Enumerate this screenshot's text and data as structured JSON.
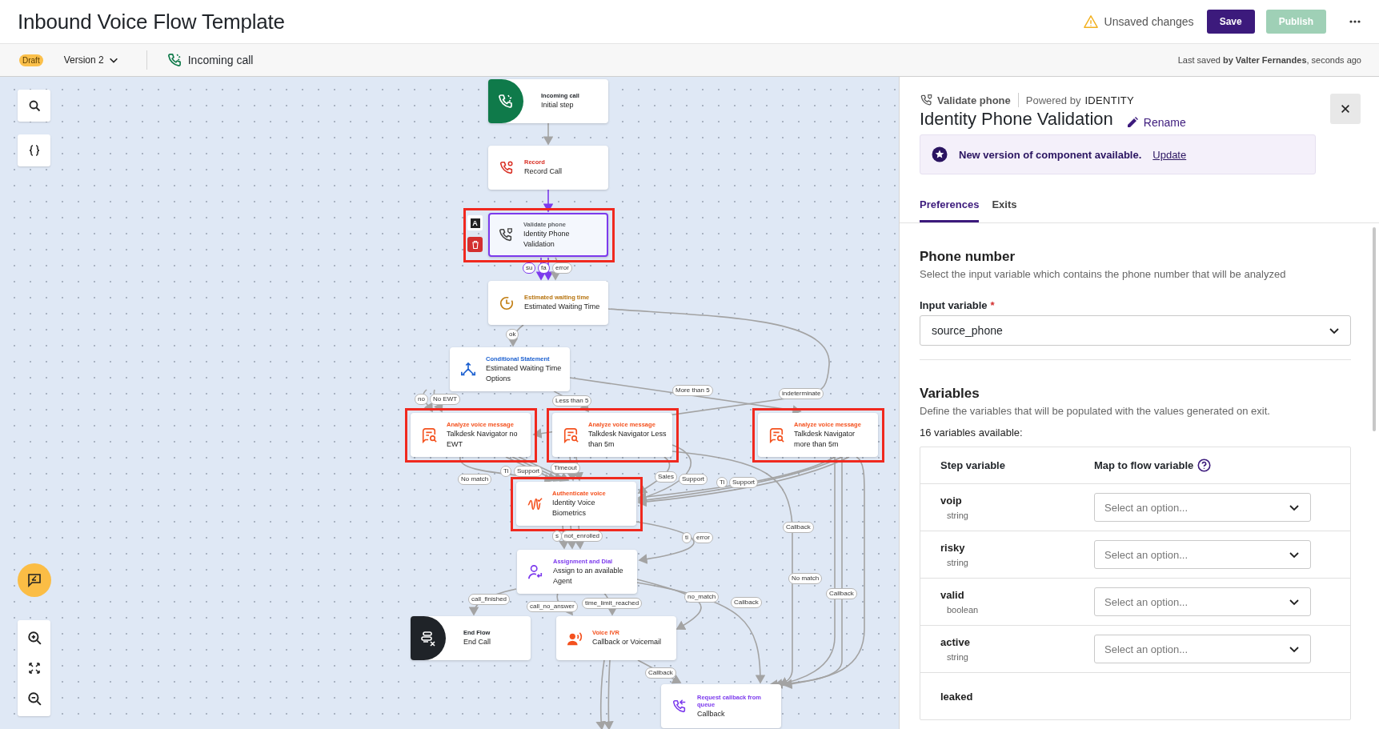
{
  "header": {
    "title": "Inbound Voice Flow Template",
    "status": "Unsaved changes",
    "buttons": [
      {
        "kind": "save",
        "label": "Save",
        "disabled": false
      },
      {
        "kind": "publish",
        "label": "Publish",
        "disabled": true
      }
    ]
  },
  "subbar": {
    "badge": "Draft",
    "version": "Version 2",
    "trigger": "Incoming call",
    "last_saved": "Last saved **by Valter Fernandes**, seconds ago"
  },
  "canvas": {
    "selected_tools": {
      "badge": "A"
    },
    "nodes": [
      {
        "kind": "start",
        "category": "Incoming call",
        "title": "Initial step",
        "color": "#1f2328",
        "selected": false,
        "highlighted": false
      },
      {
        "kind": "record",
        "category": "Record",
        "title": "Record Call",
        "color": "#d93025",
        "selected": false,
        "highlighted": false
      },
      {
        "kind": "validate",
        "category": "Validate phone",
        "title": "Identity Phone Validation",
        "color": "#5f6368",
        "selected": true,
        "highlighted": true
      },
      {
        "kind": "clock",
        "category": "Estimated waiting time",
        "title": "Estimated Waiting Time",
        "color": "#b7740f",
        "selected": false,
        "highlighted": false
      },
      {
        "kind": "branch",
        "category": "Conditional Statement",
        "title": "Estimated Waiting Time Options",
        "color": "#1a5fd0",
        "selected": false,
        "highlighted": false
      },
      {
        "kind": "analyze",
        "category": "Analyze voice message",
        "title": "Talkdesk Navigator no EWT",
        "color": "#f4511e",
        "selected": false,
        "highlighted": true
      },
      {
        "kind": "analyze",
        "category": "Analyze voice message",
        "title": "Talkdesk Navigator Less than 5m",
        "color": "#f4511e",
        "selected": false,
        "highlighted": true
      },
      {
        "kind": "analyze",
        "category": "Analyze voice message",
        "title": "Talkdesk Navigator more than 5m",
        "color": "#f4511e",
        "selected": false,
        "highlighted": true
      },
      {
        "kind": "biometrics",
        "category": "Authenticate voice",
        "title": "Identity Voice Biometrics",
        "color": "#f4511e",
        "selected": false,
        "highlighted": true
      },
      {
        "kind": "agent",
        "category": "Assignment and Dial",
        "title": "Assign to an available Agent",
        "color": "#7c3aed",
        "selected": false,
        "highlighted": false
      },
      {
        "kind": "end",
        "category": "End Flow",
        "title": "End Call",
        "color": "#1f2328",
        "selected": false,
        "highlighted": false
      },
      {
        "kind": "ivr",
        "category": "Voice IVR",
        "title": "Callback or Voicemail",
        "color": "#f4511e",
        "selected": false,
        "highlighted": false
      },
      {
        "kind": "callback",
        "category": "Request callback from queue",
        "title": "Callback",
        "color": "#7c3aed",
        "selected": false,
        "highlighted": false
      }
    ],
    "edge_labels": [
      {
        "text": "ok",
        "active": false
      },
      {
        "text": "su",
        "active": true
      },
      {
        "text": "fa",
        "active": true
      },
      {
        "text": "error",
        "active": false
      },
      {
        "text": "no",
        "active": false
      },
      {
        "text": "No EWT",
        "active": false
      },
      {
        "text": "Less than 5",
        "active": false
      },
      {
        "text": "More than 5",
        "active": false
      },
      {
        "text": "indeterminate",
        "active": false
      },
      {
        "text": "Ti",
        "active": false
      },
      {
        "text": "Support",
        "active": false
      },
      {
        "text": "Timeout",
        "active": false
      },
      {
        "text": "No match",
        "active": false
      },
      {
        "text": "Sales",
        "active": false
      },
      {
        "text": "Support",
        "active": false
      },
      {
        "text": "Ti",
        "active": false
      },
      {
        "text": "Support",
        "active": false
      },
      {
        "text": "Callback",
        "active": false
      },
      {
        "text": "s",
        "active": false
      },
      {
        "text": "not_enrolled",
        "active": false
      },
      {
        "text": "ti",
        "active": false
      },
      {
        "text": "error",
        "active": false
      },
      {
        "text": "call_finished",
        "active": false
      },
      {
        "text": "call_no_answer",
        "active": false
      },
      {
        "text": "time_limit_reached",
        "active": false
      },
      {
        "text": "no_match",
        "active": false
      },
      {
        "text": "Callback",
        "active": false
      },
      {
        "text": "No match",
        "active": false
      },
      {
        "text": "Callback",
        "active": false
      },
      {
        "text": "Callback",
        "active": false
      }
    ]
  },
  "panel": {
    "component": "Validate phone",
    "powered_by": "Powered by",
    "provider": "IDENTITY",
    "title": "Identity Phone Validation",
    "rename": "Rename",
    "banner": {
      "message": "New version of component available.",
      "action": "Update"
    },
    "tabs": [
      {
        "label": "Preferences",
        "selected": true
      },
      {
        "label": "Exits",
        "selected": false
      }
    ],
    "phone_section": {
      "heading": "Phone number",
      "description": "Select the input variable which contains the phone number that will be analyzed",
      "field_label": "Input variable",
      "required_mark": "*",
      "value": "source_phone"
    },
    "variables_section": {
      "heading": "Variables",
      "description": "Define the variables that will be populated with the values generated on exit.",
      "count": "16 variables available:",
      "columns": [
        "Step variable",
        "Map to flow variable"
      ],
      "rows": [
        {
          "name": "voip",
          "type": "string",
          "placeholder": "Select an option..."
        },
        {
          "name": "risky",
          "type": "string",
          "placeholder": "Select an option..."
        },
        {
          "name": "valid",
          "type": "boolean",
          "placeholder": "Select an option..."
        },
        {
          "name": "active",
          "type": "string",
          "placeholder": "Select an option..."
        },
        {
          "name": "leaked"
        }
      ]
    }
  }
}
